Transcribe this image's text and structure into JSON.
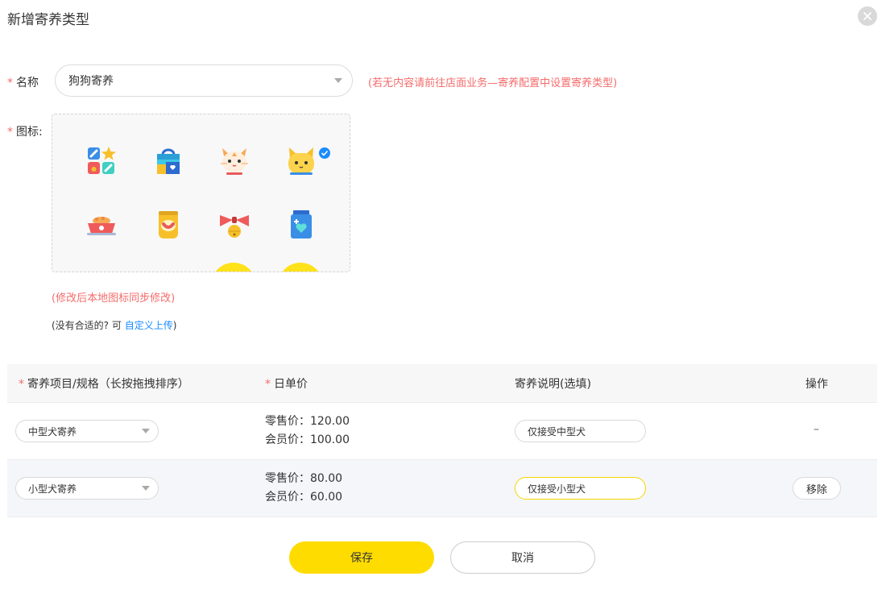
{
  "dialog": {
    "title": "新增寄养类型",
    "close_icon": "close-icon"
  },
  "form": {
    "name_label": "名称",
    "name_value": "狗狗寄养",
    "name_hint": "(若无内容请前往店面业务—寄养配置中设置寄养类型)",
    "icon_label": "图标:",
    "icon_hint": "(修改后本地图标同步修改)",
    "upload_note_prefix": "(没有合适的? 可 ",
    "upload_link": "自定义上传",
    "upload_note_suffix": ")",
    "icons": [
      "pet-items-icon",
      "pet-bag-icon",
      "cat-face-icon",
      "yellow-cat-icon",
      "pet-bowl-icon",
      "pet-food-bag-icon",
      "bow-bell-icon",
      "medicine-jar-icon"
    ],
    "selected_icon": "yellow-cat-icon"
  },
  "table": {
    "headers": {
      "item": "寄养项目/规格（长按拖拽排序）",
      "price": "日单价",
      "note": "寄养说明(选填)",
      "action": "操作"
    },
    "rows": [
      {
        "item": "中型犬寄养",
        "retail": "零售价：120.00",
        "member": "会员价：100.00",
        "note": "仅接受中型犬",
        "action": "–"
      },
      {
        "item": "小型犬寄养",
        "retail": "零售价：80.00",
        "member": "会员价：60.00",
        "note": "仅接受小型犬",
        "action": "移除"
      }
    ]
  },
  "footer": {
    "save": "保存",
    "cancel": "取消"
  },
  "colors": {
    "accent": "#ffdc00",
    "required": "#f56c6c",
    "link": "#1a8cff"
  }
}
